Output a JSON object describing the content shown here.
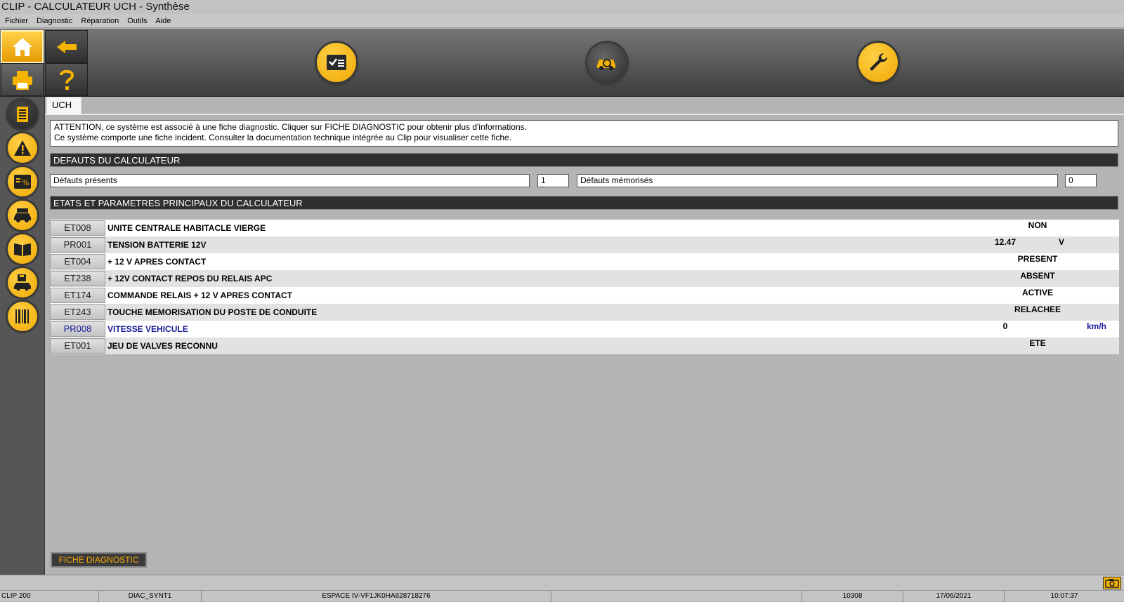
{
  "window": {
    "title": "CLIP - CALCULATEUR UCH - Synthèse"
  },
  "menu": [
    "Fichier",
    "Diagnostic",
    "Réparation",
    "Outils",
    "Aide"
  ],
  "toolbar": {
    "home": "home-icon",
    "back": "back-arrow-icon",
    "print": "printer-icon",
    "help": "help-icon",
    "center_buttons": [
      "checklist-icon",
      "vehicle-diagnostic-icon",
      "wrench-icon"
    ]
  },
  "sidebar": [
    "document-icon",
    "warning-icon",
    "percent-icon",
    "car-icon",
    "book-icon",
    "save-car-icon",
    "barcode-icon"
  ],
  "tab": {
    "label": "UCH"
  },
  "attention": {
    "line1": "ATTENTION, ce système est associé à une fiche diagnostic. Cliquer sur FICHE DIAGNOSTIC pour obtenir plus d'informations.",
    "line2": "Ce système comporte une fiche incident. Consulter la documentation technique intégrée au Clip pour visualiser cette fiche."
  },
  "defauts": {
    "title": "DEFAUTS DU CALCULATEUR",
    "presents_label": "Défauts présents",
    "presents_value": "1",
    "memorises_label": "Défauts mémorisés",
    "memorises_value": "0"
  },
  "etats": {
    "title": "ETATS ET PARAMETRES PRINCIPAUX DU CALCULATEUR",
    "rows": [
      {
        "code": "ET008",
        "label": "UNITE CENTRALE HABITACLE VIERGE",
        "value": "NON",
        "unit": ""
      },
      {
        "code": "PR001",
        "label": "TENSION BATTERIE 12V",
        "value": "12.47",
        "unit": "V"
      },
      {
        "code": "ET004",
        "label": "+ 12 V APRES CONTACT",
        "value": "PRESENT",
        "unit": ""
      },
      {
        "code": "ET238",
        "label": "+ 12V CONTACT REPOS DU RELAIS APC",
        "value": "ABSENT",
        "unit": ""
      },
      {
        "code": "ET174",
        "label": "COMMANDE RELAIS + 12 V APRES CONTACT",
        "value": "ACTIVE",
        "unit": ""
      },
      {
        "code": "ET243",
        "label": "TOUCHE MEMORISATION DU POSTE DE CONDUITE",
        "value": "RELACHEE",
        "unit": ""
      },
      {
        "code": "PR008",
        "label": "VITESSE VEHICULE",
        "value": "0",
        "unit": "km/h"
      },
      {
        "code": "ET001",
        "label": "JEU DE VALVES RECONNU",
        "value": "ETE",
        "unit": ""
      }
    ]
  },
  "fiche_button": "FICHE DIAGNOSTIC",
  "status": {
    "device": "CLIP 200",
    "screen": "DIAC_SYNT1",
    "vehicle": "ESPACE IV-VF1JK0HA628718276",
    "empty": "",
    "code": "10308",
    "date": "17/06/2021",
    "time": "10:07:37"
  },
  "colors": {
    "accent": "#f5a800",
    "blue": "#1a1a9a"
  }
}
